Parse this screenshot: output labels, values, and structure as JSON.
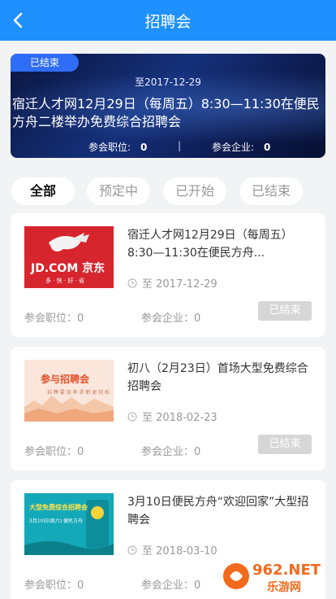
{
  "header": {
    "title": "招聘会",
    "back_icon": "chevron-left-icon"
  },
  "banner": {
    "badge": "已结束",
    "date": "至2017-12-29",
    "title": "宿迁人才网12月29日（每周五）8:30—11:30在便民方舟二楼举办免费综合招聘会",
    "positions_label": "参会职位:",
    "positions_value": "0",
    "separator": "|",
    "companies_label": "参会企业:",
    "companies_value": "0"
  },
  "tabs": [
    {
      "label": "全部",
      "active": true
    },
    {
      "label": "预定中",
      "active": false
    },
    {
      "label": "已开始",
      "active": false
    },
    {
      "label": "已结束",
      "active": false
    }
  ],
  "events": [
    {
      "title": "宿迁人才网12月29日（每周五）8:30—11:30在便民方舟...",
      "date": "至 2017-12-29",
      "positions": "参会职位：0",
      "companies": "参会企业：0",
      "status": "已结束",
      "thumb": {
        "text_main": "JD.COM 京东",
        "text_sub": "多 · 快 · 好 · 省",
        "bg": "#d7252d"
      }
    },
    {
      "title": "初八（2月23日）首场大型免费综合招聘会",
      "date": "至 2018-02-23",
      "positions": "参会职位：0",
      "companies": "参会企业：0",
      "status": "已结束",
      "thumb": {
        "text_main": "参与招聘会",
        "text_sub": "招 聘 要 效 率 求 职 更 轻 松",
        "bg": "#fbe6dc"
      }
    },
    {
      "title": "3月10日便民方舟“欢迎回家”大型招聘会",
      "date": "至 2018-03-10",
      "positions": "参会职位：0",
      "companies": "参会企业：0",
      "thumb": {
        "text_main": "大型免费综合招聘会",
        "text_sub": "3月10日(周六) 便民方舟",
        "bg": "#14a9b8"
      }
    }
  ],
  "watermark": {
    "text_main": "962.NET",
    "text_sub": "乐游网"
  },
  "colors": {
    "primary": "#1e90ff",
    "banner_badge": "#2f6df6",
    "status_gray": "#d6d6d6",
    "watermark": "#f26a1b"
  }
}
